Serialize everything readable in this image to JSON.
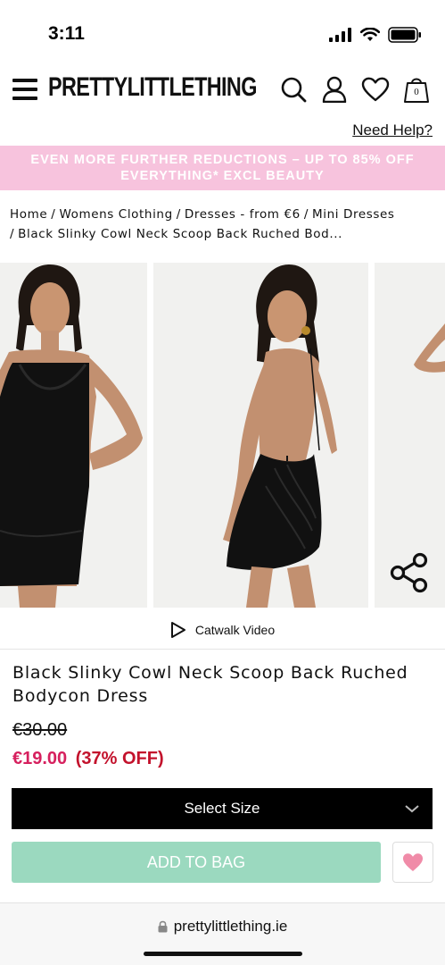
{
  "status_bar": {
    "time": "3:11"
  },
  "header": {
    "brand": "PRETTYLITTLETHING",
    "bag_count": "0",
    "icons": [
      "menu-icon",
      "search-icon",
      "account-icon",
      "heart-icon",
      "bag-icon"
    ]
  },
  "help": {
    "label": "Need Help?"
  },
  "promo": {
    "line1": "EVEN MORE FURTHER REDUCTIONS – UP TO 85% OFF",
    "line2": "EVERYTHING* EXCL BEAUTY",
    "color": "#f7c3dd"
  },
  "breadcrumb": {
    "items": [
      "Home",
      "Womens Clothing",
      "Dresses - from €6",
      "Mini Dresses"
    ],
    "current": "Black Slinky Cowl Neck Scoop Back Ruched Bod..."
  },
  "gallery": {
    "catwalk_label": "Catwalk Video"
  },
  "product": {
    "title": "Black Slinky Cowl Neck Scoop Back Ruched Bodycon Dress",
    "old_price": "€30.00",
    "new_price": "€19.00",
    "discount": "(37% OFF)",
    "sale_color": "#d6205e"
  },
  "actions": {
    "size_label": "Select Size",
    "add_to_bag": "ADD TO BAG",
    "add_to_bag_color": "#9bd9bf"
  },
  "browser": {
    "url": "prettylittlething.ie"
  }
}
